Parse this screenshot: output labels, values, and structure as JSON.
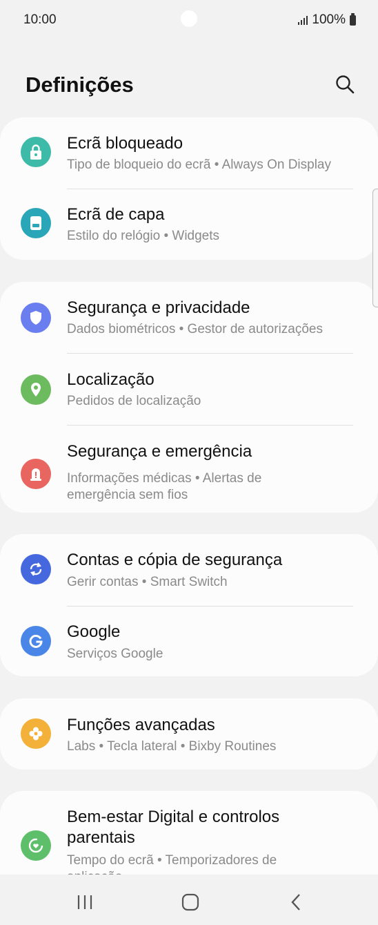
{
  "status_bar": {
    "time": "10:00",
    "battery": "100%"
  },
  "header": {
    "title": "Definições"
  },
  "items": [
    {
      "title": "Ecrã bloqueado",
      "subtitle": "Tipo de bloqueio do ecrã  •  Always On Display",
      "icon": "lock-icon",
      "color": "#3dbba8"
    },
    {
      "title": "Ecrã de capa",
      "subtitle": "Estilo do relógio  •  Widgets",
      "icon": "cover-screen-icon",
      "color": "#29a7b8"
    },
    {
      "title": "Segurança e privacidade",
      "subtitle": "Dados biométricos  •  Gestor de autorizações",
      "icon": "shield-icon",
      "color": "#6b7ef0"
    },
    {
      "title": "Localização",
      "subtitle": "Pedidos de localização",
      "icon": "location-pin-icon",
      "color": "#6cbb5f"
    },
    {
      "title": "Segurança e emergência",
      "subtitle": "Informações médicas  •  Alertas de",
      "subtitle2": "emergência sem fios",
      "icon": "emergency-icon",
      "color": "#e8665f"
    },
    {
      "title": "Contas e cópia de segurança",
      "subtitle": "Gerir contas  •  Smart Switch",
      "icon": "sync-icon",
      "color": "#4668de"
    },
    {
      "title": "Google",
      "subtitle": "Serviços Google",
      "icon": "google-icon",
      "color": "#4a86e8"
    },
    {
      "title": "Funções avançadas",
      "subtitle": "Labs  •  Tecla lateral  •  Bixby Routines",
      "icon": "advanced-features-icon",
      "color": "#f4b13a"
    },
    {
      "title": "Bem-estar Digital e controlos",
      "title2": "parentais",
      "subtitle": "Tempo do ecrã  •  Temporizadores de",
      "subtitle2": "aplicação",
      "icon": "digital-wellbeing-icon",
      "color": "#5dbf6a"
    }
  ]
}
